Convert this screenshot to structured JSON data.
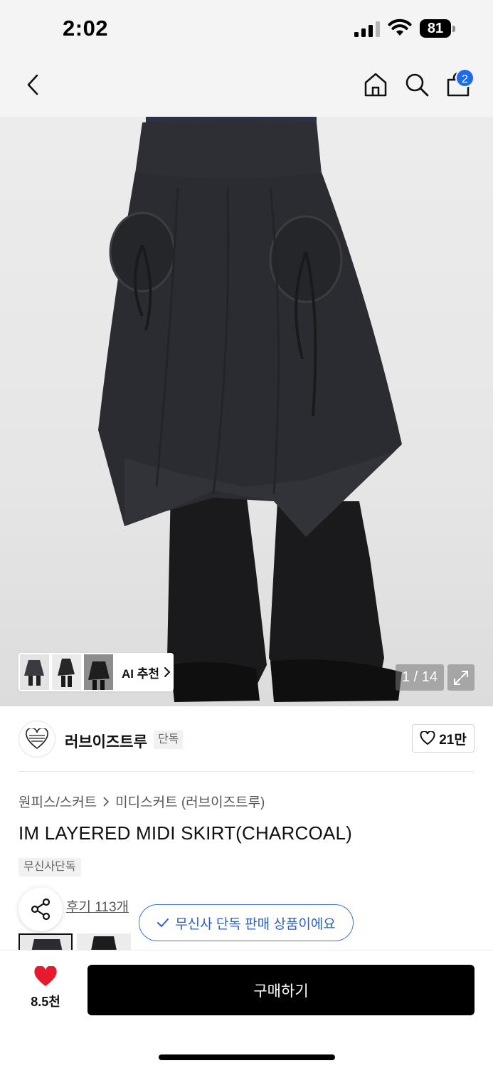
{
  "status": {
    "time": "2:02",
    "battery": "81"
  },
  "nav": {
    "cart_count": "2"
  },
  "gallery": {
    "ai_label": "AI 추천",
    "counter": "1 / 14"
  },
  "brand": {
    "name": "러브이즈트루",
    "badge": "단독",
    "like_count": "21만"
  },
  "product": {
    "breadcrumb": [
      "원피스/스커트",
      "미디스커트 (러브이즈트루)"
    ],
    "title": "IM LAYERED MIDI SKIRT(CHARCOAL)",
    "tag": "무신사단독",
    "review_link": "후기 113개",
    "exclusive_notice": "무신사 단독 판매 상품이에요"
  },
  "bottom": {
    "heart_count": "8.5천",
    "buy_label": "구매하기"
  },
  "colors": {
    "accent": "#1f6bf0",
    "heart": "#e8192c",
    "pill": "#2a5fcc"
  }
}
